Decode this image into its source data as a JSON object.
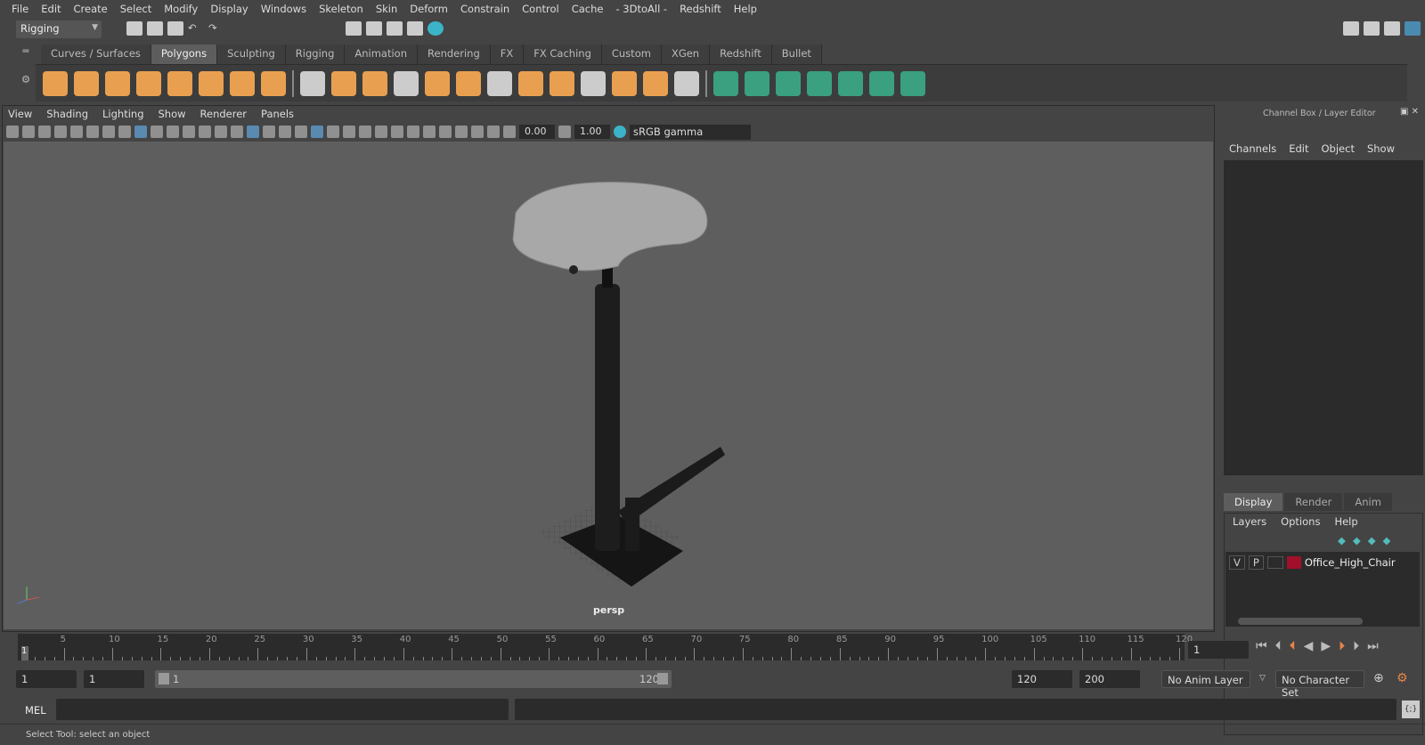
{
  "menubar": [
    "File",
    "Edit",
    "Create",
    "Select",
    "Modify",
    "Display",
    "Windows",
    "Skeleton",
    "Skin",
    "Deform",
    "Constrain",
    "Control",
    "Cache",
    "- 3DtoAll -",
    "Redshift",
    "Help"
  ],
  "status_line": {
    "menu_set": "Rigging"
  },
  "shelf": {
    "tabs": [
      "Curves / Surfaces",
      "Polygons",
      "Sculpting",
      "Rigging",
      "Animation",
      "Rendering",
      "FX",
      "FX Caching",
      "Custom",
      "XGen",
      "Redshift",
      "Bullet"
    ],
    "active": "Polygons",
    "accent": "#e8a050"
  },
  "viewport": {
    "menus": [
      "View",
      "Shading",
      "Lighting",
      "Show",
      "Renderer",
      "Panels"
    ],
    "exposure": "0.00",
    "gamma": "1.00",
    "color_space": "sRGB gamma",
    "camera_label": "persp",
    "background": "#5e5e5e"
  },
  "channel_box": {
    "title": "Channel Box / Layer Editor",
    "menus": [
      "Channels",
      "Edit",
      "Object",
      "Show"
    ]
  },
  "layer_editor": {
    "tabs": [
      "Display",
      "Render",
      "Anim"
    ],
    "active_tab": "Display",
    "menus": [
      "Layers",
      "Options",
      "Help"
    ],
    "layers": [
      {
        "v": "V",
        "p": "P",
        "color": "#a0102a",
        "name": "Office_High_Chair"
      }
    ]
  },
  "timeline": {
    "ticks": [
      "5",
      "10",
      "15",
      "20",
      "25",
      "30",
      "35",
      "40",
      "45",
      "50",
      "55",
      "60",
      "65",
      "70",
      "75",
      "80",
      "85",
      "90",
      "95",
      "100",
      "105",
      "110",
      "115",
      "120"
    ],
    "current": "1",
    "current_frame_field": "1"
  },
  "range": {
    "start": "1",
    "playback_start": "1",
    "slider_start": "1",
    "slider_end": "120",
    "playback_end": "120",
    "end": "200",
    "anim_layer": "No Anim Layer",
    "character_set": "No Character Set"
  },
  "command_line": {
    "label": "MEL"
  },
  "help_line": "Select Tool: select an object"
}
